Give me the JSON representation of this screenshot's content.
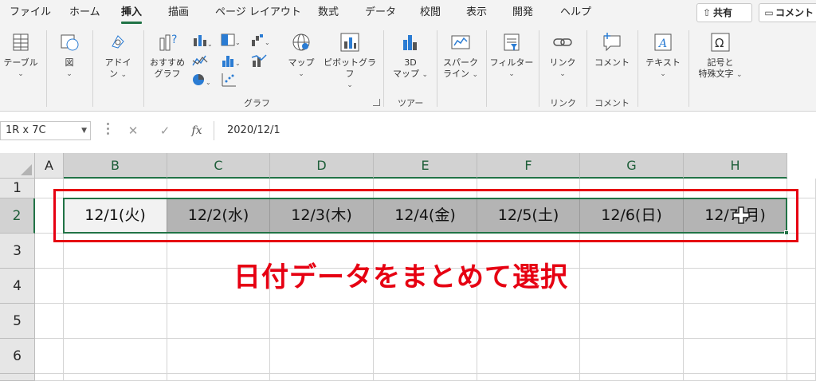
{
  "menu": {
    "tabs": [
      "ファイル",
      "ホーム",
      "挿入",
      "描画",
      "ページ レイアウト",
      "数式",
      "データ",
      "校閲",
      "表示",
      "開発",
      "ヘルプ"
    ],
    "active_tab": "挿入",
    "share_label": "共有",
    "comment_label": "コメント"
  },
  "ribbon": {
    "table_label": "テーブル",
    "illustration_label": "図",
    "addin_label_1": "アドイ",
    "addin_label_2": "ン",
    "recommended_label_1": "おすすめ",
    "recommended_label_2": "グラフ",
    "map_label": "マップ",
    "pivot_chart_label": "ピボットグラフ",
    "map3d_label_1": "3D",
    "map3d_label_2": "マップ",
    "sparkline_label_1": "スパーク",
    "sparkline_label_2": "ライン",
    "filter_label": "フィルター",
    "link_label": "リンク",
    "comment_label": "コメント",
    "text_label": "テキスト",
    "symbol_label_1": "記号と",
    "symbol_label_2": "特殊文字",
    "group_chart": "グラフ",
    "group_tour": "ツアー",
    "group_link": "リンク",
    "group_comment": "コメント"
  },
  "formula_bar": {
    "name_box": "1R x 7C",
    "cancel": "✕",
    "enter": "✓",
    "fx": "fx",
    "value": "2020/12/1"
  },
  "sheet": {
    "columns": [
      "A",
      "B",
      "C",
      "D",
      "E",
      "F",
      "G",
      "H"
    ],
    "rows": [
      "1",
      "2",
      "3",
      "4",
      "5",
      "6"
    ],
    "row2_values": [
      "12/1(火)",
      "12/2(水)",
      "12/3(木)",
      "12/4(金)",
      "12/5(土)",
      "12/6(日)",
      "12/7(月)"
    ]
  },
  "annotation": "日付データをまとめて選択",
  "colors": {
    "excel_green": "#217346",
    "annotation_red": "#e60012",
    "selection_fill": "#b4b4b4"
  }
}
